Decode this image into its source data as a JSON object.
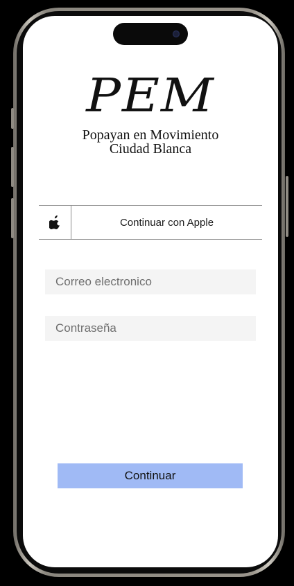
{
  "logo": {
    "text": "PEM"
  },
  "subtitle": {
    "line1": "Popayan en Movimiento",
    "line2": "Ciudad Blanca"
  },
  "apple_login": {
    "label": "Continuar con Apple",
    "icon": "apple-icon"
  },
  "email": {
    "placeholder": "Correo electronico",
    "value": ""
  },
  "password": {
    "placeholder": "Contraseña",
    "value": ""
  },
  "continue_button": {
    "label": "Continuar"
  },
  "colors": {
    "primary_button": "#a0baf5",
    "field_background": "#f4f4f4",
    "screen_background": "#ffffff"
  }
}
